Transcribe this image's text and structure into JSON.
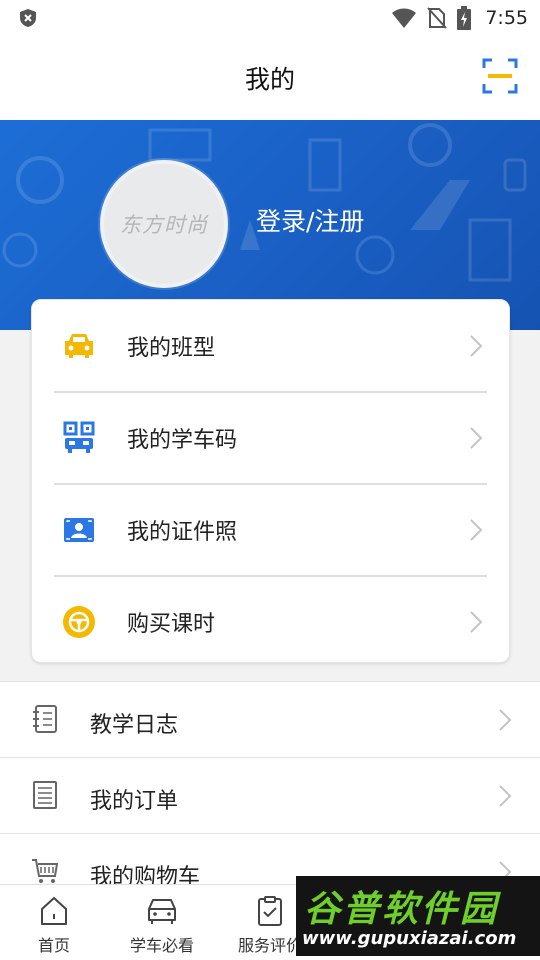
{
  "status_bar": {
    "time": "7:55",
    "icons": [
      "shield-x-icon",
      "wifi-icon",
      "no-sim-icon",
      "battery-charging-icon"
    ]
  },
  "header": {
    "title": "我的",
    "scan_icon": "scan-icon"
  },
  "profile": {
    "avatar_text": "东方时尚",
    "login_label": "登录/注册"
  },
  "card_menu": [
    {
      "label": "我的班型",
      "icon": "car-icon",
      "icon_color": "#f5b800"
    },
    {
      "label": "我的学车码",
      "icon": "qr-bus-icon",
      "icon_color": "#2b78e4"
    },
    {
      "label": "我的证件照",
      "icon": "id-photo-icon",
      "icon_color": "#2b78e4"
    },
    {
      "label": "购买课时",
      "icon": "steering-wheel-icon",
      "icon_color": "#f5b800"
    }
  ],
  "list_menu": [
    {
      "label": "教学日志",
      "icon": "notebook-icon"
    },
    {
      "label": "我的订单",
      "icon": "order-list-icon"
    },
    {
      "label": "我的购物车",
      "icon": "shopping-cart-icon"
    }
  ],
  "bottom_nav": [
    {
      "label": "首页",
      "icon": "home-icon"
    },
    {
      "label": "学车必看",
      "icon": "car-outline-icon"
    },
    {
      "label": "服务评价",
      "icon": "clipboard-check-icon"
    }
  ],
  "watermark": {
    "cn": "谷普软件园",
    "url": "www.gupuxiazai.com"
  },
  "colors": {
    "banner_blue": "#1a62c8",
    "accent_yellow": "#f5b800",
    "accent_blue": "#2b78e4"
  }
}
